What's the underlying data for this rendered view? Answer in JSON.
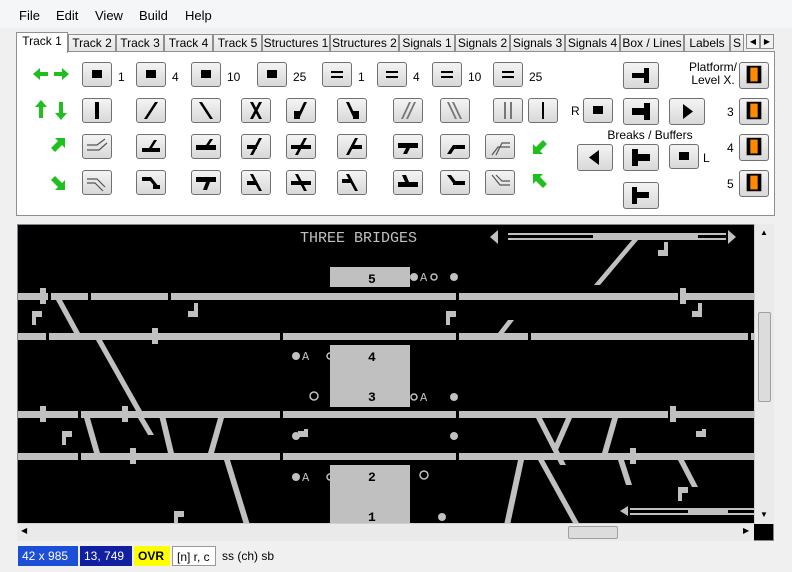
{
  "menu": [
    "File",
    "Edit",
    "View",
    "Build",
    "Help"
  ],
  "tabs": [
    "Track 1",
    "Track 2",
    "Track 3",
    "Track 4",
    "Track 5",
    "Structures 1",
    "Structures 2",
    "Signals 1",
    "Signals 2",
    "Signals 3",
    "Signals 4",
    "Box / Lines",
    "Labels",
    "S"
  ],
  "active_tab": "Track 1",
  "palette": {
    "numbers": [
      "1",
      "4",
      "10",
      "25"
    ],
    "platform_label": "Platform/ Level X.",
    "breaks_label": "Breaks / Buffers",
    "r_label": "R",
    "l_label": "L",
    "level_numbers": [
      "3",
      "4",
      "5"
    ]
  },
  "canvas": {
    "station_name": "THREE BRIDGES",
    "platforms": [
      "5",
      "4",
      "3",
      "2",
      "1"
    ],
    "signal_glyph": "A",
    "background": "#000000",
    "track_color": "#c0c0c0"
  },
  "status": {
    "size": "42 x 985",
    "coords": "13, 749",
    "mode": "OVR",
    "hint": "[n] r, c",
    "keys": "ss (ch) sb"
  },
  "colors": {
    "arrow_green": "#1fbf1f",
    "status_size_bg": "#1c4fd6",
    "status_coords_bg": "#1020a0",
    "status_mode_bg": "#ffff00",
    "level_orange": "#ff8a00"
  }
}
